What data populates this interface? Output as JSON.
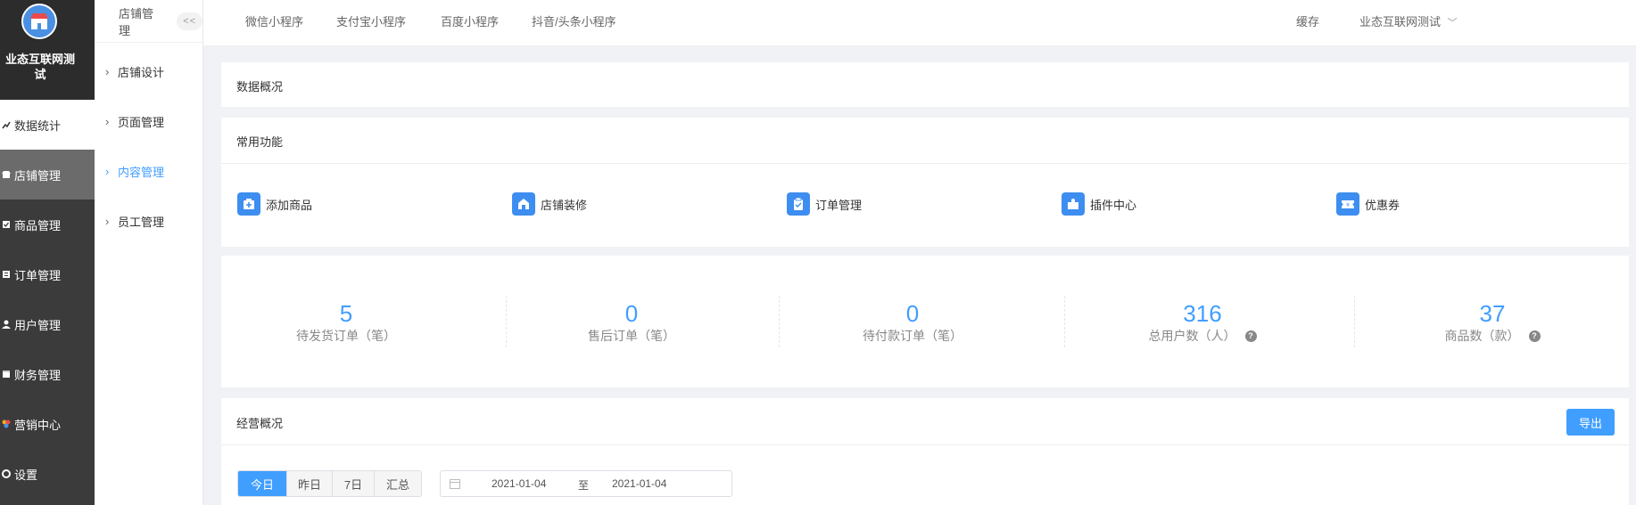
{
  "sidebar": {
    "title": "业态互联网测试",
    "items": [
      {
        "label": "数据统计",
        "icon": "chart-icon"
      },
      {
        "label": "店铺管理",
        "icon": "shop-icon"
      },
      {
        "label": "商品管理",
        "icon": "goods-icon"
      },
      {
        "label": "订单管理",
        "icon": "order-icon"
      },
      {
        "label": "用户管理",
        "icon": "user-icon"
      },
      {
        "label": "财务管理",
        "icon": "finance-icon"
      },
      {
        "label": "营销中心",
        "icon": "marketing-icon"
      },
      {
        "label": "设置",
        "icon": "settings-icon"
      }
    ]
  },
  "subbar": {
    "title": "店铺管理",
    "collapse": "<<",
    "items": [
      {
        "label": "店铺设计"
      },
      {
        "label": "页面管理"
      },
      {
        "label": "内容管理"
      },
      {
        "label": "员工管理"
      }
    ]
  },
  "topbar": {
    "tabs": [
      "微信小程序",
      "支付宝小程序",
      "百度小程序",
      "抖音/头条小程序"
    ],
    "cache": "缓存",
    "account": "业态互联网测试"
  },
  "overview": {
    "title": "数据概况"
  },
  "common": {
    "title": "常用功能",
    "items": [
      {
        "label": "添加商品",
        "icon": "add-product-icon"
      },
      {
        "label": "店铺装修",
        "icon": "store-decor-icon"
      },
      {
        "label": "订单管理",
        "icon": "order-clipboard-icon"
      },
      {
        "label": "插件中心",
        "icon": "plugin-icon"
      },
      {
        "label": "优惠券",
        "icon": "coupon-icon"
      }
    ]
  },
  "stats": [
    {
      "value": "5",
      "label": "待发货订单（笔）"
    },
    {
      "value": "0",
      "label": "售后订单（笔）"
    },
    {
      "value": "0",
      "label": "待付款订单（笔）"
    },
    {
      "value": "316",
      "label": "总用户数（人）"
    },
    {
      "value": "37",
      "label": "商品数（款）"
    }
  ],
  "business": {
    "title": "经营概况",
    "export": "导出",
    "ranges": [
      "今日",
      "昨日",
      "7日",
      "汇总"
    ],
    "date_from": "2021-01-04",
    "date_sep": "至",
    "date_to": "2021-01-04"
  },
  "colors": {
    "accent": "#409eff",
    "sidebar": "#3b3b3b"
  }
}
